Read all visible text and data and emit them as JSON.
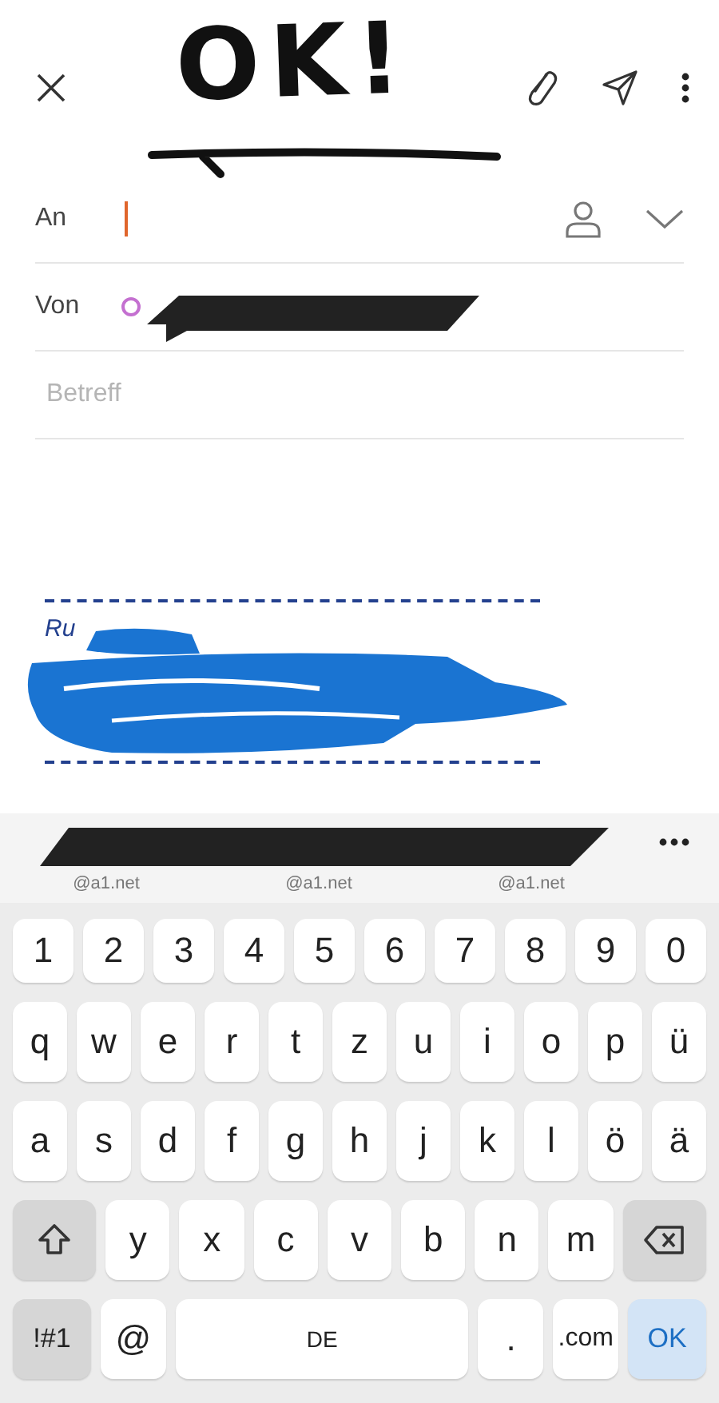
{
  "annotation": "OK!",
  "fields": [
    {
      "kind": "recipient",
      "label": "An"
    },
    {
      "kind": "sender",
      "label": "Von"
    },
    {
      "kind": "subject",
      "placeholder": "Betreff"
    }
  ],
  "signature": {
    "visible_text": "Ru"
  },
  "suggestions": [
    "@a1.net",
    "@a1.net",
    "@a1.net"
  ],
  "keyboard": {
    "rows": [
      {
        "keys": [
          {
            "label": "1",
            "kind": "char"
          },
          {
            "label": "2",
            "kind": "char"
          },
          {
            "label": "3",
            "kind": "char"
          },
          {
            "label": "4",
            "kind": "char"
          },
          {
            "label": "5",
            "kind": "char"
          },
          {
            "label": "6",
            "kind": "char"
          },
          {
            "label": "7",
            "kind": "char"
          },
          {
            "label": "8",
            "kind": "char"
          },
          {
            "label": "9",
            "kind": "char"
          },
          {
            "label": "0",
            "kind": "char"
          }
        ]
      },
      {
        "keys": [
          {
            "label": "q",
            "kind": "char"
          },
          {
            "label": "w",
            "kind": "char"
          },
          {
            "label": "e",
            "kind": "char"
          },
          {
            "label": "r",
            "kind": "char"
          },
          {
            "label": "t",
            "kind": "char"
          },
          {
            "label": "z",
            "kind": "char"
          },
          {
            "label": "u",
            "kind": "char"
          },
          {
            "label": "i",
            "kind": "char"
          },
          {
            "label": "o",
            "kind": "char"
          },
          {
            "label": "p",
            "kind": "char"
          },
          {
            "label": "ü",
            "kind": "char"
          }
        ]
      },
      {
        "keys": [
          {
            "label": "a",
            "kind": "char"
          },
          {
            "label": "s",
            "kind": "char"
          },
          {
            "label": "d",
            "kind": "char"
          },
          {
            "label": "f",
            "kind": "char"
          },
          {
            "label": "g",
            "kind": "char"
          },
          {
            "label": "h",
            "kind": "char"
          },
          {
            "label": "j",
            "kind": "char"
          },
          {
            "label": "k",
            "kind": "char"
          },
          {
            "label": "l",
            "kind": "char"
          },
          {
            "label": "ö",
            "kind": "char"
          },
          {
            "label": "ä",
            "kind": "char"
          }
        ]
      },
      {
        "keys": [
          {
            "kind": "shift"
          },
          {
            "label": "y",
            "kind": "char"
          },
          {
            "label": "x",
            "kind": "char"
          },
          {
            "label": "c",
            "kind": "char"
          },
          {
            "label": "v",
            "kind": "char"
          },
          {
            "label": "b",
            "kind": "char"
          },
          {
            "label": "n",
            "kind": "char"
          },
          {
            "label": "m",
            "kind": "char"
          },
          {
            "kind": "backspace"
          }
        ]
      },
      {
        "keys": [
          {
            "label": "!#1",
            "kind": "mod"
          },
          {
            "label": "@",
            "kind": "char"
          },
          {
            "label": "DE",
            "kind": "space"
          },
          {
            "label": ".",
            "kind": "char"
          },
          {
            "label": ".com",
            "kind": "char"
          },
          {
            "label": "OK",
            "kind": "enter"
          }
        ]
      }
    ]
  }
}
